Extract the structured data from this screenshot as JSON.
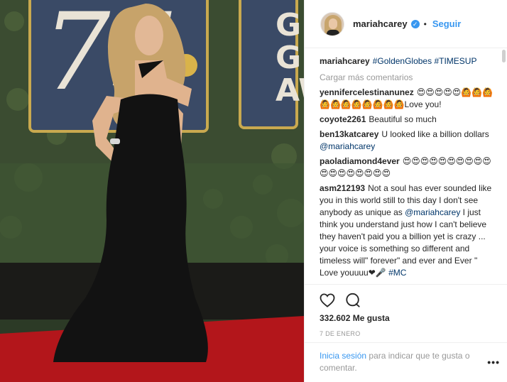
{
  "post": {
    "username": "mariahcarey",
    "follow_label": "Seguir",
    "separator": "•",
    "verified_icon": "verified-check-icon"
  },
  "caption": {
    "user": "mariahcarey",
    "text": "#GoldenGlobes #TIMESUP"
  },
  "load_more": "Cargar más comentarios",
  "comments": [
    {
      "user": "yennifercelestinanunez",
      "text": "😍😍😍😍😍🙆🙆🙆🙆🙆🙆🙆🙆🙆🙆🙆Love you!"
    },
    {
      "user": "coyote2261",
      "text": "Beautiful so much"
    },
    {
      "user": "ben13katcarey",
      "text": "U looked like a billion dollars",
      "mention": "@mariahcarey"
    },
    {
      "user": "paoladiamond4ever",
      "text": "😍😍😍😍😍😍😍😍😍😍😍😍😍😍😍😍😍😍"
    },
    {
      "user": "asm212193",
      "text": "Not a soul has ever sounded like you in this world still to this day I don't see anybody as unique as",
      "mention": "@mariahcarey",
      "text2": "I just think you understand just how I can't believe they haven't paid you a billion yet is crazy ... your voice is something so different and timeless will\" forever\" and ever and Ever \" Love youuuu❤🎤",
      "tag": "#MC"
    }
  ],
  "likes": "332.602 Me gusta",
  "date": "7 DE ENERO",
  "login": {
    "link": "Inicia sesión",
    "text": "para indicar que te gusta o comentar."
  },
  "more_label": "•••",
  "icons": [
    "heart-icon",
    "comment-icon",
    "more-options-icon"
  ],
  "colors": {
    "link": "#3897f0",
    "tag": "#003569",
    "muted": "#999999",
    "carpet": "#b3161b"
  }
}
